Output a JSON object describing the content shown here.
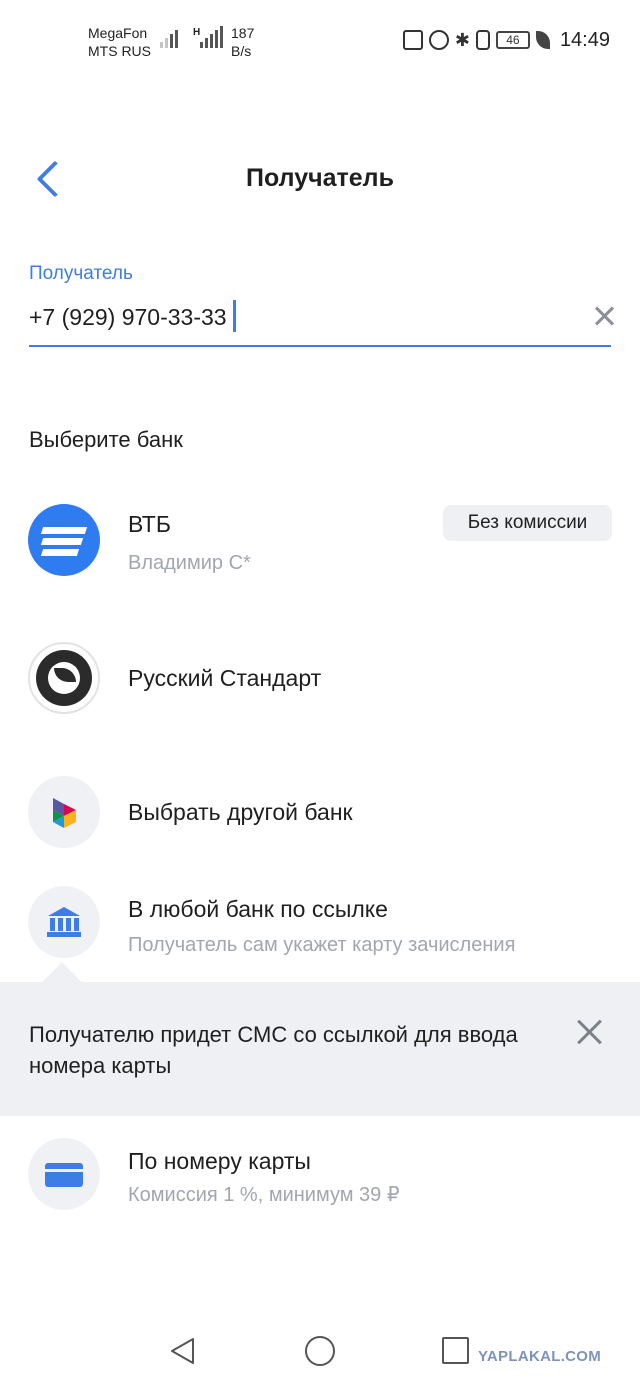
{
  "status_bar": {
    "carrier1": "MegaFon",
    "carrier2": "MTS RUS",
    "network_letter": "H",
    "speed_value": "187",
    "speed_unit": "B/s",
    "battery": "46",
    "time": "14:49",
    "icons": [
      "nfc-icon",
      "alarm-icon",
      "bluetooth-icon",
      "vibrate-icon",
      "battery-icon",
      "leaf-icon"
    ]
  },
  "header": {
    "title": "Получатель",
    "back_icon": "chevron-left-icon"
  },
  "recipient": {
    "label": "Получатель",
    "value": "+7 (929) 970-33-33",
    "accent": "#3e7ce6"
  },
  "bank_section": {
    "title": "Выберите банк",
    "items": [
      {
        "title": "ВТБ",
        "subtitle": "Владимир С*",
        "badge": "Без комиссии",
        "icon": "vtb-logo"
      },
      {
        "title": "Русский Стандарт",
        "icon": "russian-standard-logo"
      },
      {
        "title": "Выбрать другой банк",
        "icon": "sbp-logo"
      },
      {
        "title": "В любой банк по ссылке",
        "subtitle": "Получатель сам укажет карту зачисления",
        "icon": "bank-building-icon"
      },
      {
        "title": "По номеру карты",
        "subtitle": "Комиссия 1 %, минимум 39 ₽",
        "icon": "card-icon"
      }
    ]
  },
  "tooltip": {
    "text": "Получателю придет СМС со ссылкой для ввода номера карты"
  },
  "watermark": "YAPLAKAL.COM"
}
